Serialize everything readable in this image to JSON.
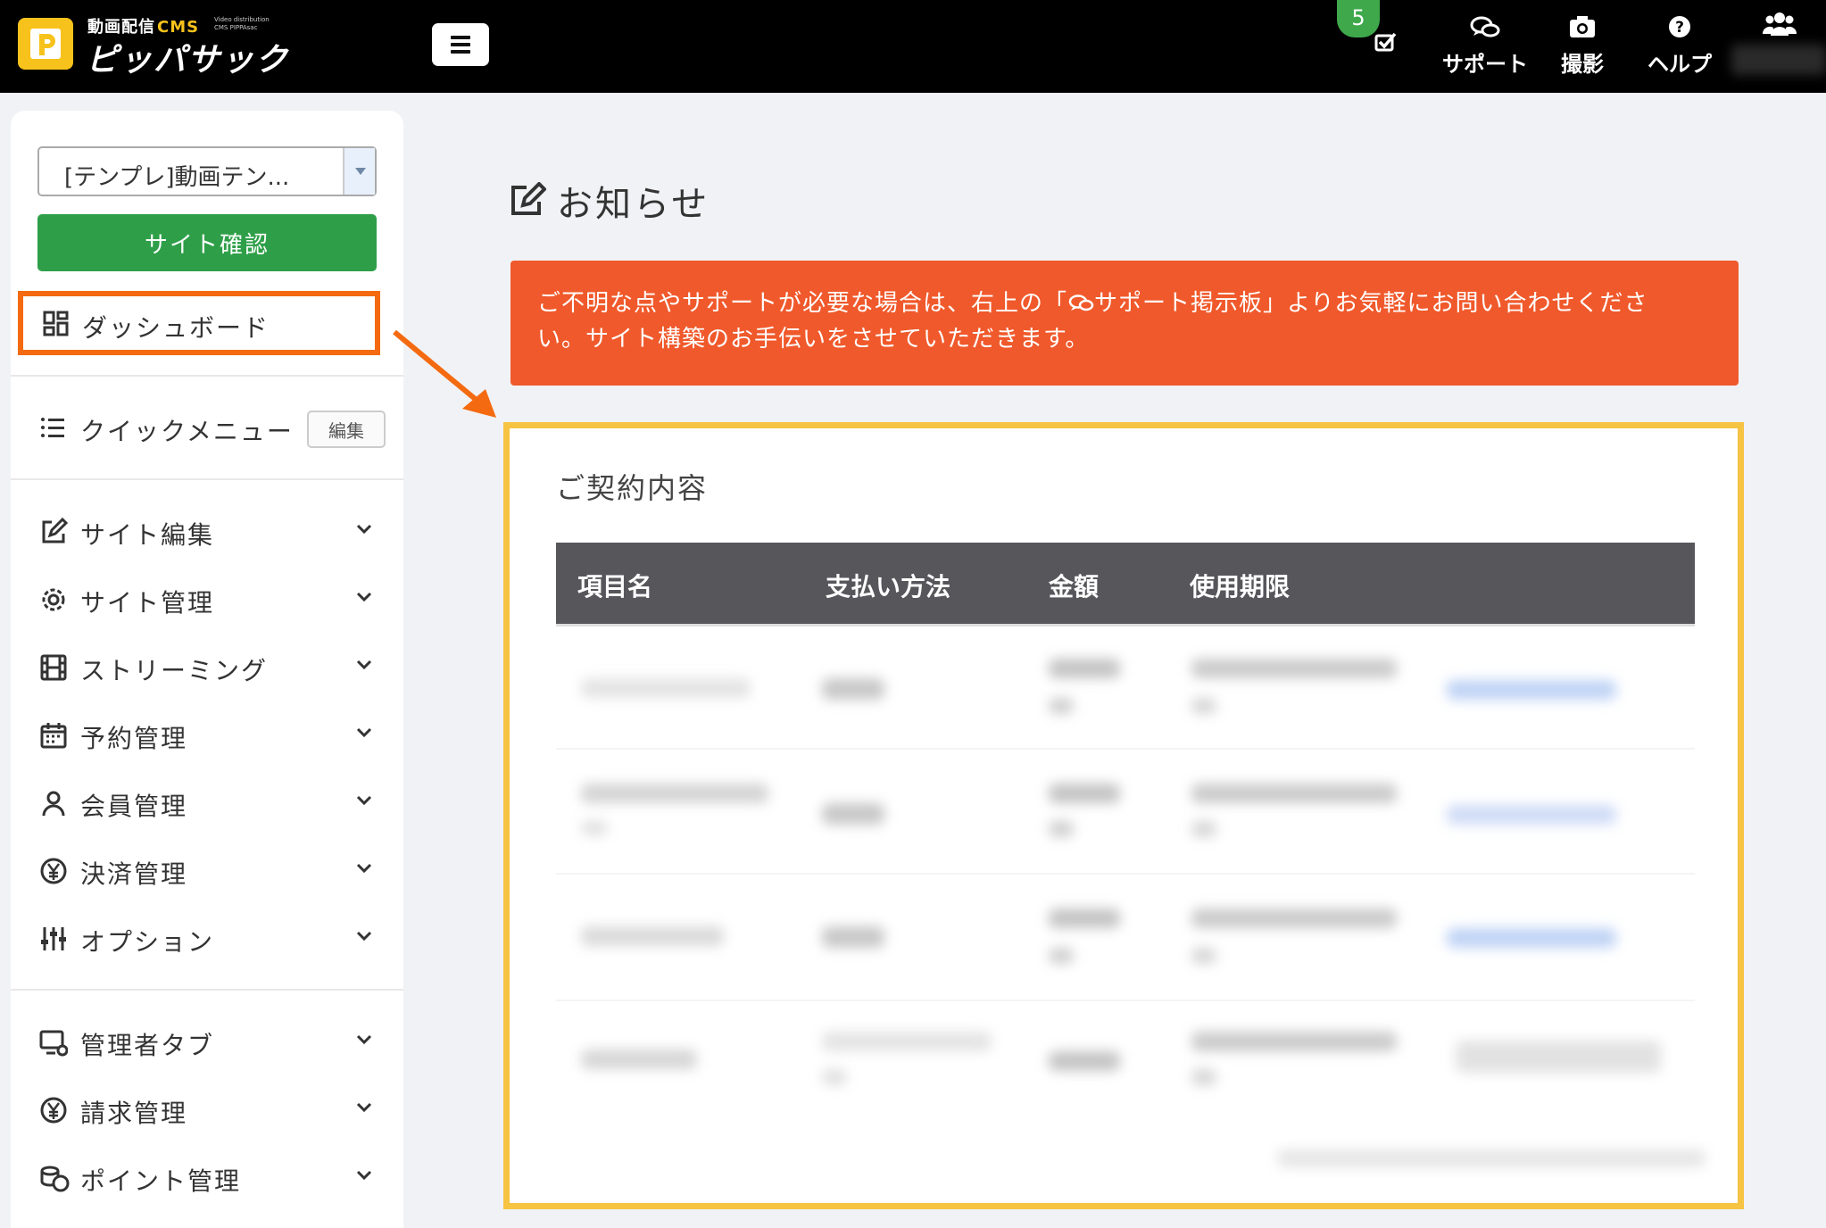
{
  "header": {
    "brand_top": "動画配信",
    "brand_cms": "CMS",
    "brand_small": "Video distribution CMS PIPPAsac",
    "brand_main": "ピッパサック",
    "notification_count": "5",
    "nav": [
      {
        "label": "サポート",
        "icon": "chat-icon"
      },
      {
        "label": "撮影",
        "icon": "camera-icon"
      },
      {
        "label": "ヘルプ",
        "icon": "help-icon"
      }
    ]
  },
  "sidebar": {
    "site_select_value": "[テンプレ]動画テン...",
    "site_button": "サイト確認",
    "dashboard": "ダッシュボード",
    "quick_menu": "クイックメニュー",
    "quick_menu_edit": "編集",
    "items": [
      {
        "label": "サイト編集",
        "icon": "edit-icon"
      },
      {
        "label": "サイト管理",
        "icon": "gear-icon"
      },
      {
        "label": "ストリーミング",
        "icon": "film-icon"
      },
      {
        "label": "予約管理",
        "icon": "calendar-icon"
      },
      {
        "label": "会員管理",
        "icon": "user-icon"
      },
      {
        "label": "決済管理",
        "icon": "yen-icon"
      },
      {
        "label": "オプション",
        "icon": "sliders-icon"
      }
    ],
    "items2": [
      {
        "label": "管理者タブ",
        "icon": "monitor-gear-icon"
      },
      {
        "label": "請求管理",
        "icon": "yen-icon"
      },
      {
        "label": "ポイント管理",
        "icon": "coins-icon"
      }
    ]
  },
  "main": {
    "title": "お知らせ",
    "notice_line1": "ご不明な点やサポートが必要な場合は、右上の「",
    "notice_link": "サポート掲示板",
    "notice_line1_end": "」よりお気軽にお問い合わせくださ",
    "notice_line2": "い。サイト構築のお手伝いをさせていただきます。",
    "contract_title": "ご契約内容",
    "table_headers": [
      "項目名",
      "支払い方法",
      "金額",
      "使用期限"
    ]
  },
  "colors": {
    "header_bg": "#000000",
    "brand_yellow": "#f7c21b",
    "site_button": "#2e9f48",
    "notice_bg": "#f0592b",
    "highlight_orange": "#f46a10",
    "highlight_yellow": "#f6c342",
    "table_header": "#57565b"
  }
}
